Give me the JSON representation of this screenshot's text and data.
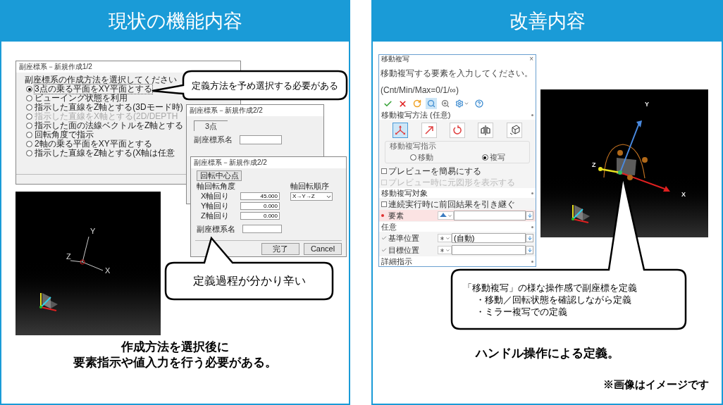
{
  "left_panel": {
    "title": "現状の機能内容",
    "dialog_1": {
      "title": "副座標系－新規作成1/2",
      "prompt": "副座標系の作成方法を選択してください",
      "options": [
        {
          "label": "3点の乗る平面をXY平面とする",
          "selected": true,
          "disabled": false
        },
        {
          "label": "ビューイング状態を利用",
          "selected": false,
          "disabled": false
        },
        {
          "label": "指示した直線をZ軸とする(3Dモード時)",
          "selected": false,
          "disabled": false
        },
        {
          "label": "指示した直線をX軸とする(2D/DEPTH",
          "selected": false,
          "disabled": true
        },
        {
          "label": "指示した面の法線ベクトルをZ軸とする",
          "selected": false,
          "disabled": false
        },
        {
          "label": "回転角度で指示",
          "selected": false,
          "disabled": false
        },
        {
          "label": "2軸の乗る平面をXY平面とする",
          "selected": false,
          "disabled": false
        },
        {
          "label": "指示した直線をZ軸とする(X軸は任意",
          "selected": false,
          "disabled": false
        }
      ]
    },
    "dialog_2": {
      "title": "副座標系－新規作成2/2",
      "group_label": "3点",
      "name_label": "副座標系名"
    },
    "dialog_3": {
      "title": "副座標系－新規作成2/2",
      "center_button": "回転中心点",
      "angle_heading": "軸回転角度",
      "angles": [
        {
          "label": "X軸回り",
          "value": "45.000"
        },
        {
          "label": "Y軸回り",
          "value": "0.000"
        },
        {
          "label": "Z軸回り",
          "value": "0.000"
        }
      ],
      "name_label": "副座標系名",
      "order_label": "軸回転順序",
      "order_value": "X→Y→Z",
      "buttons": [
        "完了",
        "Cancel"
      ]
    },
    "callouts": [
      "定義方法を予め選択する必要がある",
      "定義過程が分かり辛い"
    ],
    "viewport": {
      "axis_labels": [
        "Y",
        "Z",
        "X"
      ]
    },
    "caption": [
      "作成方法を選択後に",
      "要素指示や値入力を行う必要がある。"
    ]
  },
  "right_panel": {
    "title": "改善内容",
    "dialog": {
      "title": "移動複写",
      "close": "×",
      "prompt": "移動複写する要素を入力してください。(Cnt/Min/Max=0/1/∞)",
      "toolbar": [
        {
          "kind": "check",
          "selected": false
        },
        {
          "kind": "cancel",
          "selected": false
        },
        {
          "kind": "redo",
          "selected": false
        },
        {
          "kind": "search",
          "selected": true
        },
        {
          "kind": "pick",
          "selected": false
        },
        {
          "kind": "settings",
          "selected": false
        },
        {
          "kind": "help",
          "selected": false
        }
      ],
      "rows": [
        {
          "kind": "section",
          "label": "移動複写方法 (任意)"
        },
        {
          "kind": "modes",
          "items": [
            {
              "kind": "move",
              "selected": true
            },
            {
              "kind": "arrow",
              "selected": false
            },
            {
              "kind": "rotate",
              "selected": false
            },
            {
              "kind": "mirror",
              "selected": false
            },
            {
              "kind": "box",
              "selected": false
            }
          ]
        },
        {
          "kind": "radio_group",
          "label": "移動複写指示",
          "options": [
            {
              "label": "移動",
              "selected": false
            },
            {
              "label": "複写",
              "selected": true
            }
          ]
        },
        {
          "kind": "checkbox",
          "label": "プレビューを簡易にする",
          "checked": false,
          "disabled": false
        },
        {
          "kind": "checkbox",
          "label": "プレビュー時に元図形を表示する",
          "checked": false,
          "disabled": true
        },
        {
          "kind": "section",
          "label": "移動複写対象"
        },
        {
          "kind": "checkbox",
          "label": "連続実行時に前回結果を引き継ぐ",
          "checked": false,
          "disabled": false
        },
        {
          "kind": "input",
          "label": "要素",
          "required": true,
          "selector": {
            "kind": "hat"
          }
        },
        {
          "kind": "section",
          "label": "任意"
        },
        {
          "kind": "input",
          "label": "基準位置",
          "required": false,
          "selector": {
            "kind": "asterisk"
          },
          "value": "(自動)"
        },
        {
          "kind": "input",
          "label": "目標位置",
          "required": false,
          "selector": {
            "kind": "asterisk"
          }
        },
        {
          "kind": "section",
          "label": "詳細指示"
        }
      ]
    },
    "viewport": {
      "axis_labels": [
        "Y",
        "Z",
        "X"
      ]
    },
    "callout": [
      "「移動複写」の様な操作感で副座標を定義",
      "・移動／回転状態を確認しながら定義",
      "・ミラー複写での定義"
    ],
    "caption": "ハンドル操作による定義。",
    "note": "※画像はイメージです"
  }
}
